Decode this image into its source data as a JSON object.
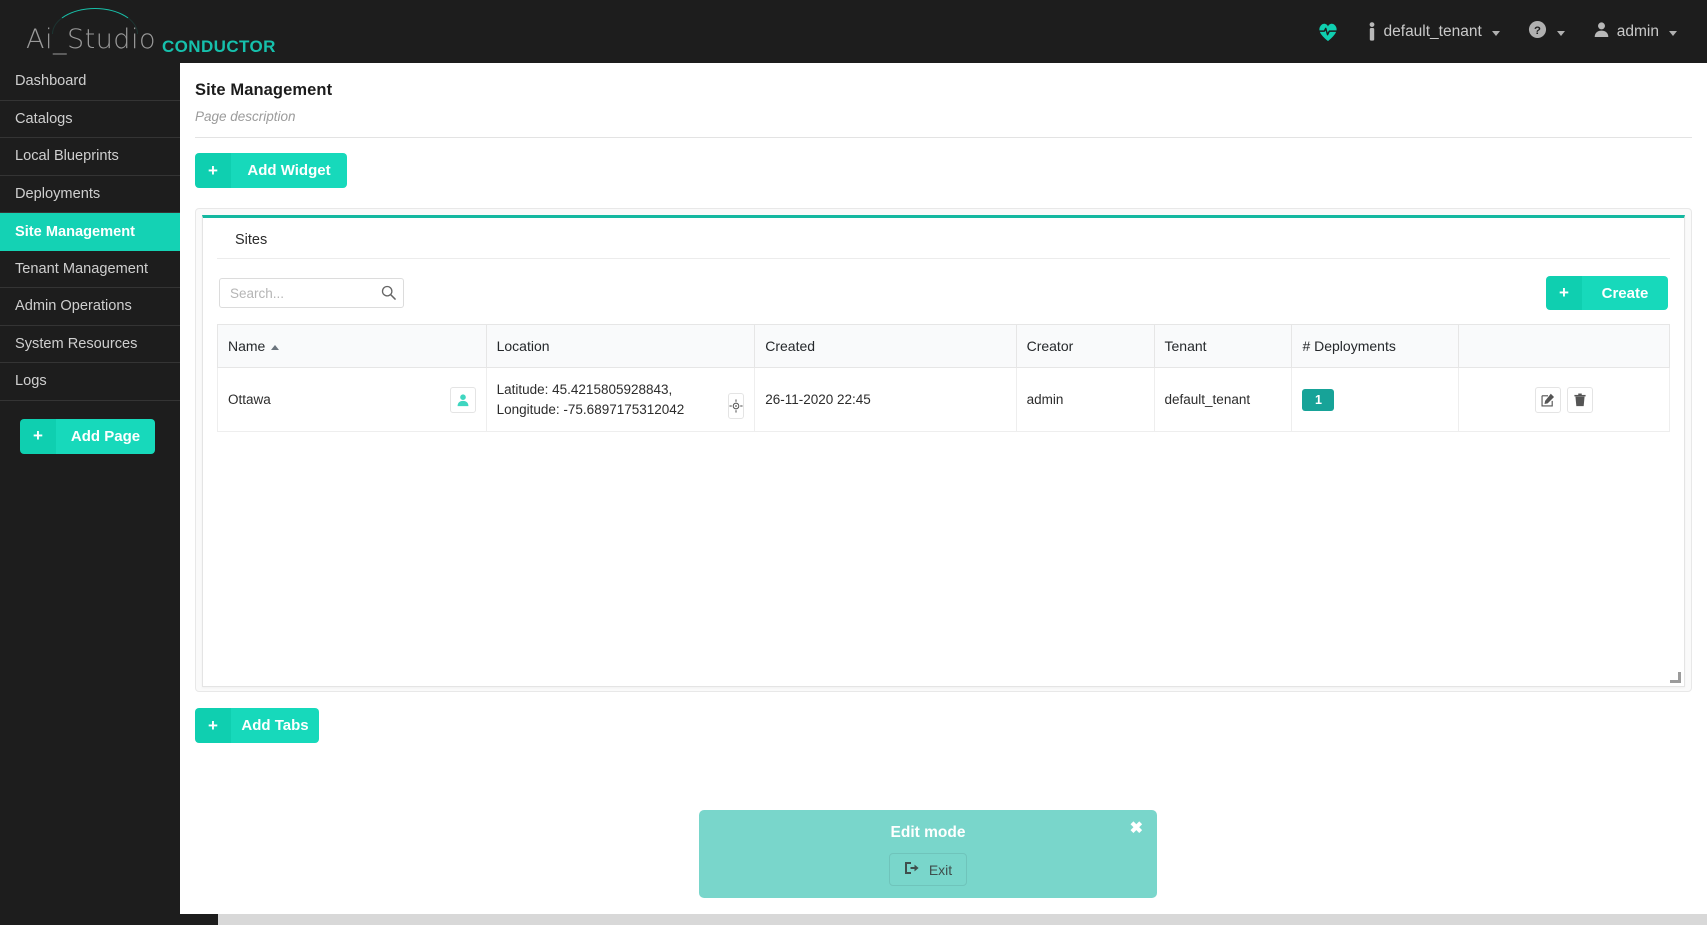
{
  "brand": {
    "name": "Ai_Studio",
    "product": "CONDUCTOR",
    "accent": "#16c0ac"
  },
  "header": {
    "health_icon": "heartbeat-icon",
    "tenant_icon": "person-icon",
    "tenant_label": "default_tenant",
    "help_icon": "question-circle-icon",
    "user_icon": "user-icon",
    "user_label": "admin"
  },
  "sidebar": {
    "items": [
      {
        "label": "Dashboard",
        "active": false
      },
      {
        "label": "Catalogs",
        "active": false
      },
      {
        "label": "Local Blueprints",
        "active": false
      },
      {
        "label": "Deployments",
        "active": false
      },
      {
        "label": "Site Management",
        "active": true
      },
      {
        "label": "Tenant Management",
        "active": false
      },
      {
        "label": "Admin Operations",
        "active": false
      },
      {
        "label": "System Resources",
        "active": false
      },
      {
        "label": "Logs",
        "active": false
      }
    ],
    "add_page": {
      "plus": "+",
      "label": "Add Page"
    }
  },
  "page": {
    "title": "Site Management",
    "description": "Page description",
    "add_widget": {
      "plus": "+",
      "label": "Add Widget"
    },
    "add_tabs": {
      "plus": "+",
      "label": "Add Tabs"
    }
  },
  "widget": {
    "title": "Sites",
    "search": {
      "value": "",
      "placeholder": "Search...",
      "icon": "search-icon"
    },
    "create": {
      "plus": "+",
      "label": "Create"
    },
    "table": {
      "columns": [
        "Name",
        "Location",
        "Created",
        "Creator",
        "Tenant",
        "# Deployments",
        ""
      ],
      "sorted_column": "Name",
      "sort_direction": "asc",
      "rows": [
        {
          "name": "Ottawa",
          "name_icon": "user-avatar-icon",
          "location": "Latitude: 45.4215805928843, Longitude: -75.6897175312042",
          "location_icon": "crosshair-icon",
          "created": "26-11-2020 22:45",
          "creator": "admin",
          "tenant": "default_tenant",
          "deployments": "1",
          "actions": [
            "edit-icon",
            "delete-icon"
          ]
        }
      ]
    },
    "accent": "#14b8a0"
  },
  "edit_mode": {
    "title": "Edit mode",
    "close": "✖",
    "exit_label": "Exit",
    "exit_icon": "sign-out-icon",
    "background": "#79d6cb"
  }
}
